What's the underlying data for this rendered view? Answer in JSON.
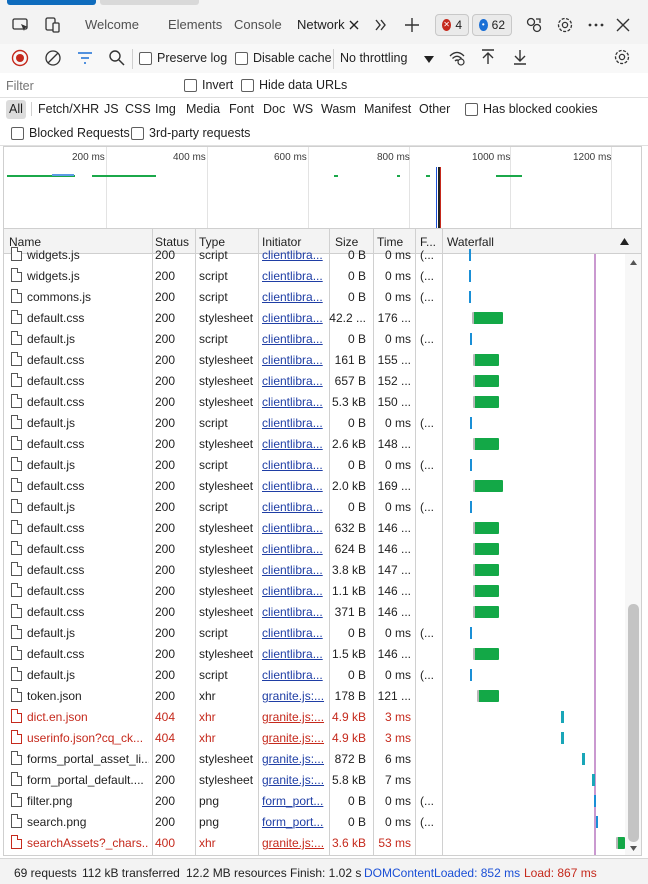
{
  "tabbar": {
    "tabs": [
      {
        "label": "Welcome"
      },
      {
        "label": "Elements"
      },
      {
        "label": "Console"
      },
      {
        "label": "Network"
      }
    ],
    "errors_count": "4",
    "issues_count": "62"
  },
  "toolbar": {
    "preserve_log_label": "Preserve log",
    "disable_cache_label": "Disable cache",
    "throttling_value": "No throttling"
  },
  "filter": {
    "placeholder": "Filter",
    "invert_label": "Invert",
    "hide_data_urls_label": "Hide data URLs",
    "types": [
      "All",
      "Fetch/XHR",
      "JS",
      "CSS",
      "Img",
      "Media",
      "Font",
      "Doc",
      "WS",
      "Wasm",
      "Manifest",
      "Other"
    ],
    "has_blocked_cookies_label": "Has blocked cookies",
    "blocked_requests_label": "Blocked Requests",
    "third_party_label": "3rd-party requests"
  },
  "overview": {
    "ticks": [
      "200 ms",
      "400 ms",
      "600 ms",
      "800 ms",
      "1000 ms",
      "1200 ms"
    ]
  },
  "table": {
    "headers": {
      "name": "Name",
      "status": "Status",
      "type": "Type",
      "initiator": "Initiator",
      "size": "Size",
      "time": "Time",
      "fulfilled": "F...",
      "waterfall": "Waterfall"
    },
    "rows": [
      {
        "name": "widgets.js",
        "status": "200",
        "type": "script",
        "initiator": "clientlibra...",
        "size": "0 B",
        "time": "0 ms",
        "f": "(...",
        "err": false
      },
      {
        "name": "widgets.js",
        "status": "200",
        "type": "script",
        "initiator": "clientlibra...",
        "size": "0 B",
        "time": "0 ms",
        "f": "(...",
        "err": false
      },
      {
        "name": "commons.js",
        "status": "200",
        "type": "script",
        "initiator": "clientlibra...",
        "size": "0 B",
        "time": "0 ms",
        "f": "(...",
        "err": false
      },
      {
        "name": "default.css",
        "status": "200",
        "type": "stylesheet",
        "initiator": "clientlibra...",
        "size": "42.2 ...",
        "time": "176 ...",
        "f": "",
        "err": false
      },
      {
        "name": "default.js",
        "status": "200",
        "type": "script",
        "initiator": "clientlibra...",
        "size": "0 B",
        "time": "0 ms",
        "f": "(...",
        "err": false
      },
      {
        "name": "default.css",
        "status": "200",
        "type": "stylesheet",
        "initiator": "clientlibra...",
        "size": "161 B",
        "time": "155 ...",
        "f": "",
        "err": false
      },
      {
        "name": "default.css",
        "status": "200",
        "type": "stylesheet",
        "initiator": "clientlibra...",
        "size": "657 B",
        "time": "152 ...",
        "f": "",
        "err": false
      },
      {
        "name": "default.css",
        "status": "200",
        "type": "stylesheet",
        "initiator": "clientlibra...",
        "size": "5.3 kB",
        "time": "150 ...",
        "f": "",
        "err": false
      },
      {
        "name": "default.js",
        "status": "200",
        "type": "script",
        "initiator": "clientlibra...",
        "size": "0 B",
        "time": "0 ms",
        "f": "(...",
        "err": false
      },
      {
        "name": "default.css",
        "status": "200",
        "type": "stylesheet",
        "initiator": "clientlibra...",
        "size": "2.6 kB",
        "time": "148 ...",
        "f": "",
        "err": false
      },
      {
        "name": "default.js",
        "status": "200",
        "type": "script",
        "initiator": "clientlibra...",
        "size": "0 B",
        "time": "0 ms",
        "f": "(...",
        "err": false
      },
      {
        "name": "default.css",
        "status": "200",
        "type": "stylesheet",
        "initiator": "clientlibra...",
        "size": "2.0 kB",
        "time": "169 ...",
        "f": "",
        "err": false
      },
      {
        "name": "default.js",
        "status": "200",
        "type": "script",
        "initiator": "clientlibra...",
        "size": "0 B",
        "time": "0 ms",
        "f": "(...",
        "err": false
      },
      {
        "name": "default.css",
        "status": "200",
        "type": "stylesheet",
        "initiator": "clientlibra...",
        "size": "632 B",
        "time": "146 ...",
        "f": "",
        "err": false
      },
      {
        "name": "default.css",
        "status": "200",
        "type": "stylesheet",
        "initiator": "clientlibra...",
        "size": "624 B",
        "time": "146 ...",
        "f": "",
        "err": false
      },
      {
        "name": "default.css",
        "status": "200",
        "type": "stylesheet",
        "initiator": "clientlibra...",
        "size": "3.8 kB",
        "time": "147 ...",
        "f": "",
        "err": false
      },
      {
        "name": "default.css",
        "status": "200",
        "type": "stylesheet",
        "initiator": "clientlibra...",
        "size": "1.1 kB",
        "time": "146 ...",
        "f": "",
        "err": false
      },
      {
        "name": "default.css",
        "status": "200",
        "type": "stylesheet",
        "initiator": "clientlibra...",
        "size": "371 B",
        "time": "146 ...",
        "f": "",
        "err": false
      },
      {
        "name": "default.js",
        "status": "200",
        "type": "script",
        "initiator": "clientlibra...",
        "size": "0 B",
        "time": "0 ms",
        "f": "(...",
        "err": false
      },
      {
        "name": "default.css",
        "status": "200",
        "type": "stylesheet",
        "initiator": "clientlibra...",
        "size": "1.5 kB",
        "time": "146 ...",
        "f": "",
        "err": false
      },
      {
        "name": "default.js",
        "status": "200",
        "type": "script",
        "initiator": "clientlibra...",
        "size": "0 B",
        "time": "0 ms",
        "f": "(...",
        "err": false
      },
      {
        "name": "token.json",
        "status": "200",
        "type": "xhr",
        "initiator": "granite.js:...",
        "size": "178 B",
        "time": "121 ...",
        "f": "",
        "err": false
      },
      {
        "name": "dict.en.json",
        "status": "404",
        "type": "xhr",
        "initiator": "granite.js:...",
        "size": "4.9 kB",
        "time": "3 ms",
        "f": "",
        "err": true
      },
      {
        "name": "userinfo.json?cq_ck...",
        "status": "404",
        "type": "xhr",
        "initiator": "granite.js:...",
        "size": "4.9 kB",
        "time": "3 ms",
        "f": "",
        "err": true
      },
      {
        "name": "forms_portal_asset_li...",
        "status": "200",
        "type": "stylesheet",
        "initiator": "granite.js:...",
        "size": "872 B",
        "time": "6 ms",
        "f": "",
        "err": false
      },
      {
        "name": "form_portal_default....",
        "status": "200",
        "type": "stylesheet",
        "initiator": "granite.js:...",
        "size": "5.8 kB",
        "time": "7 ms",
        "f": "",
        "err": false
      },
      {
        "name": "filter.png",
        "status": "200",
        "type": "png",
        "initiator": "form_port...",
        "size": "0 B",
        "time": "0 ms",
        "f": "(...",
        "err": false
      },
      {
        "name": "search.png",
        "status": "200",
        "type": "png",
        "initiator": "form_port...",
        "size": "0 B",
        "time": "0 ms",
        "f": "(...",
        "err": false
      },
      {
        "name": "searchAssets?_chars...",
        "status": "400",
        "type": "xhr",
        "initiator": "granite.js:...",
        "size": "3.6 kB",
        "time": "53 ms",
        "f": "",
        "err": true
      }
    ]
  },
  "status": {
    "requests": "69 requests",
    "transferred": "112 kB transferred",
    "resources": "12.2 MB resources",
    "finish": "Finish: 1.02 s",
    "dcl": "DOMContentLoaded: 852 ms",
    "load": "Load: 867 ms",
    "dcl_color": "#1a4fd6",
    "load_color": "#c5291c"
  },
  "icons": [
    "device-icon",
    "inspect-icon",
    "close-icon",
    "more-tabs-icon",
    "add-tab-icon",
    "error-icon",
    "issues-icon",
    "connect-icon",
    "gear-icon",
    "more-icon",
    "close-devtools-icon",
    "record-icon",
    "clear-icon",
    "filter-icon",
    "search-icon",
    "network-conditions-icon",
    "import-icon",
    "export-icon",
    "settings-icon",
    "sort-arrow-icon",
    "file-icon"
  ]
}
